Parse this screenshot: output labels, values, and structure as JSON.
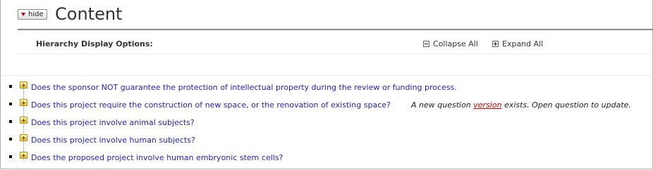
{
  "header": {
    "hide_label": "hide",
    "title": "Content"
  },
  "options": {
    "label": "Hierarchy Display Options:",
    "collapse_all": "Collapse All",
    "expand_all": "Expand All"
  },
  "questions": [
    {
      "text": "Does the sponsor NOT guarantee the protection of intellectual property during the review or funding process."
    },
    {
      "text": "Does this project require the construction of new space, or the renovation of existing space?",
      "note_prefix": "A new question",
      "note_link": "version",
      "note_suffix": "exists. Open question to update."
    },
    {
      "text": "Does this project involve animal subjects?"
    },
    {
      "text": "Does this project involve human subjects?"
    },
    {
      "text": "Does the proposed project involve human embryonic stem cells?"
    }
  ],
  "colors": {
    "link": "#1e1ec8",
    "version_link": "#cc0000",
    "hide_arrow": "#c00000"
  }
}
